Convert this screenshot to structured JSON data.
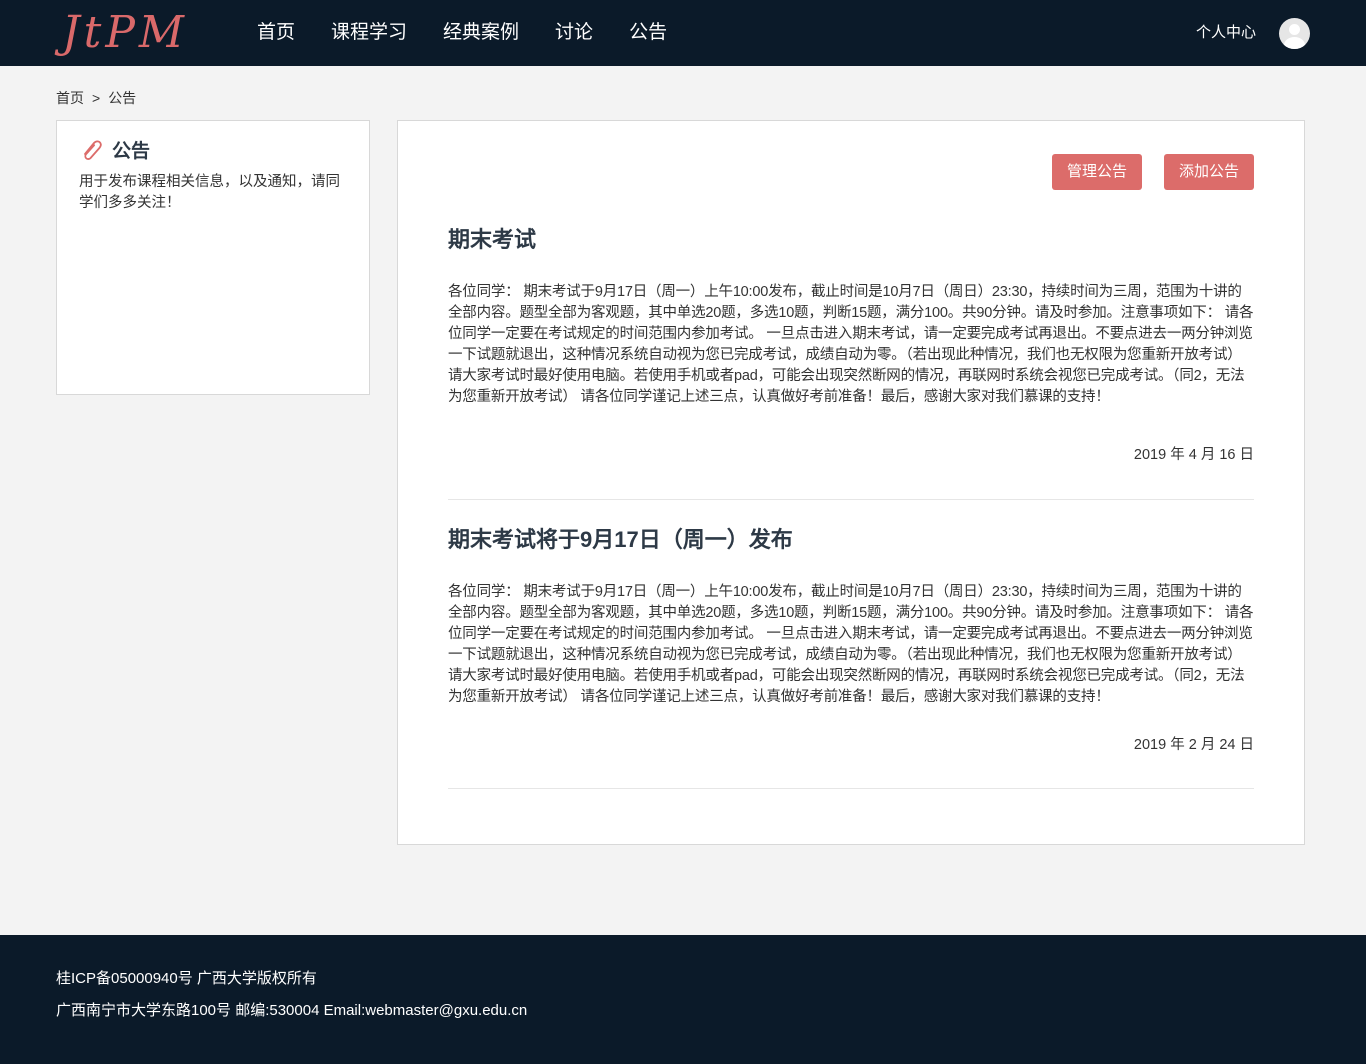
{
  "header": {
    "logo": "JtPM",
    "nav": [
      "首页",
      "课程学习",
      "经典案例",
      "讨论",
      "公告"
    ],
    "user_center": "个人中心",
    "avatar_icon": "user-avatar-icon"
  },
  "breadcrumb": {
    "home": "首页",
    "separator": ">",
    "current": "公告"
  },
  "sidebar": {
    "icon": "paperclip-icon",
    "title": "公告",
    "description": "用于发布课程相关信息，以及通知，请同学们多多关注！"
  },
  "actions": {
    "manage": "管理公告",
    "add": "添加公告"
  },
  "notices": [
    {
      "title": "期末考试",
      "body": "各位同学： 期末考试于9月17日（周一）上午10:00发布，截止时间是10月7日（周日）23:30，持续时间为三周，范围为十讲的全部内容。题型全部为客观题，其中单选20题，多选10题，判断15题，满分100。共90分钟。请及时参加。注意事项如下： 请各位同学一定要在考试规定的时间范围内参加考试。 一旦点击进入期末考试，请一定要完成考试再退出。不要点进去一两分钟浏览一下试题就退出，这种情况系统自动视为您已完成考试，成绩自动为零。（若出现此种情况，我们也无权限为您重新开放考试） 请大家考试时最好使用电脑。若使用手机或者pad，可能会出现突然断网的情况，再联网时系统会视您已完成考试。（同2，无法为您重新开放考试） 请各位同学谨记上述三点，认真做好考前准备！最后，感谢大家对我们慕课的支持！",
      "date": "2019 年 4 月 16 日"
    },
    {
      "title": "期末考试将于9月17日（周一）发布",
      "body": "各位同学： 期末考试于9月17日（周一）上午10:00发布，截止时间是10月7日（周日）23:30，持续时间为三周，范围为十讲的全部内容。题型全部为客观题，其中单选20题，多选10题，判断15题，满分100。共90分钟。请及时参加。注意事项如下： 请各位同学一定要在考试规定的时间范围内参加考试。 一旦点击进入期末考试，请一定要完成考试再退出。不要点进去一两分钟浏览一下试题就退出，这种情况系统自动视为您已完成考试，成绩自动为零。（若出现此种情况，我们也无权限为您重新开放考试） 请大家考试时最好使用电脑。若使用手机或者pad，可能会出现突然断网的情况，再联网时系统会视您已完成考试。（同2，无法为您重新开放考试） 请各位同学谨记上述三点，认真做好考前准备！最后，感谢大家对我们慕课的支持！",
      "date": "2019 年 2 月 24 日"
    }
  ],
  "footer": {
    "line1": "桂ICP备05000940号 广西大学版权所有",
    "line2": "广西南宁市大学东路100号 邮编:530004 Email:webmaster@gxu.edu.cn"
  },
  "colors": {
    "header_bg": "#0b1a29",
    "accent": "#dc6c6a",
    "title_text": "#2d3946"
  }
}
